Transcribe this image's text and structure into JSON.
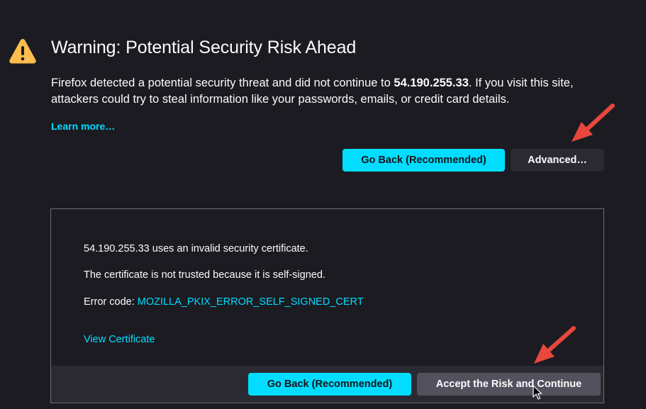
{
  "warning": {
    "title": "Warning: Potential Security Risk Ahead",
    "description_pre": "Firefox detected a potential security threat and did not continue to ",
    "host": "54.190.255.33",
    "description_post": ". If you visit this site, attackers could try to steal information like your passwords, emails, or credit card details.",
    "learn_more": "Learn more…",
    "go_back_label": "Go Back (Recommended)",
    "advanced_label": "Advanced…"
  },
  "advanced_panel": {
    "line1": "54.190.255.33 uses an invalid security certificate.",
    "line2": "The certificate is not trusted because it is self-signed.",
    "error_code_label": "Error code: ",
    "error_code": "MOZILLA_PKIX_ERROR_SELF_SIGNED_CERT",
    "view_certificate": "View Certificate",
    "go_back_label": "Go Back (Recommended)",
    "accept_label": "Accept the Risk and Continue"
  },
  "icons": {
    "warning": "warning-triangle-icon",
    "annotation_arrow": "red-arrow-icon",
    "cursor": "mouse-pointer-icon"
  },
  "colors": {
    "background": "#1c1b22",
    "accent": "#00ddff",
    "warning_icon": "#ffbd4f",
    "annotation_arrow": "#e8473c"
  }
}
